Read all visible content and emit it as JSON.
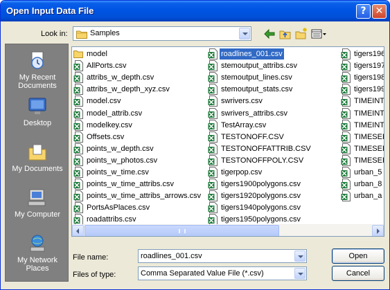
{
  "window": {
    "title": "Open Input Data File"
  },
  "titlebar": {
    "help_label": "?",
    "close_label": "✕"
  },
  "look_in": {
    "label": "Look in:",
    "value": "Samples"
  },
  "places": [
    {
      "name": "recent",
      "label": "My Recent Documents",
      "icon": "recent-documents-icon"
    },
    {
      "name": "desktop",
      "label": "Desktop",
      "icon": "desktop-icon"
    },
    {
      "name": "my-documents",
      "label": "My Documents",
      "icon": "my-documents-icon"
    },
    {
      "name": "my-computer",
      "label": "My Computer",
      "icon": "my-computer-icon"
    },
    {
      "name": "network",
      "label": "My Network Places",
      "icon": "network-places-icon"
    }
  ],
  "files": {
    "columns": [
      [
        "model",
        "AllPorts.csv",
        "attribs_w_depth.csv",
        "attribs_w_depth_xyz.csv",
        "model.csv",
        "model_attrib.csv",
        "modelkey.csv",
        "Offsets.csv",
        "points_w_depth.csv",
        "points_w_photos.csv",
        "points_w_time.csv",
        "points_w_time_attribs.csv",
        "points_w_time_attribs_arrows.csv",
        "PortsAsPlaces.csv",
        "roadattribs.csv"
      ],
      [
        "roadlines_001.csv",
        "stemoutput_attribs.csv",
        "stemoutput_lines.csv",
        "stemoutput_stats.csv",
        "swrivers.csv",
        "swrivers_attribs.csv",
        "TestArray.csv",
        "TESTONOFF.CSV",
        "TESTONOFFATTRIB.CSV",
        "TESTONOFFPOLY.CSV",
        "tigerpop.csv",
        "tigers1900polygons.csv",
        "tigers1920polygons.csv",
        "tigers1940polygons.csv",
        "tigers1950polygons.csv"
      ],
      [
        "tigers196",
        "tigers197",
        "tigers198",
        "tigers199",
        "TIMEINT",
        "TIMEINT",
        "TIMEINT",
        "TIMESER",
        "TIMESER",
        "TIMESER",
        "urban_5",
        "urban_8",
        "urban_a"
      ]
    ],
    "selected": "roadlines_001.csv"
  },
  "file_name": {
    "label": "File name:",
    "value": "roadlines_001.csv"
  },
  "file_type": {
    "label": "Files of type:",
    "value": "Comma Separated Value File (*.csv)"
  },
  "buttons": {
    "open": "Open",
    "cancel": "Cancel"
  },
  "colors": {
    "titlebar": "#0054e3",
    "selection": "#316ac5",
    "places_bar": "#808080",
    "dialog_bg": "#ece9d8"
  }
}
